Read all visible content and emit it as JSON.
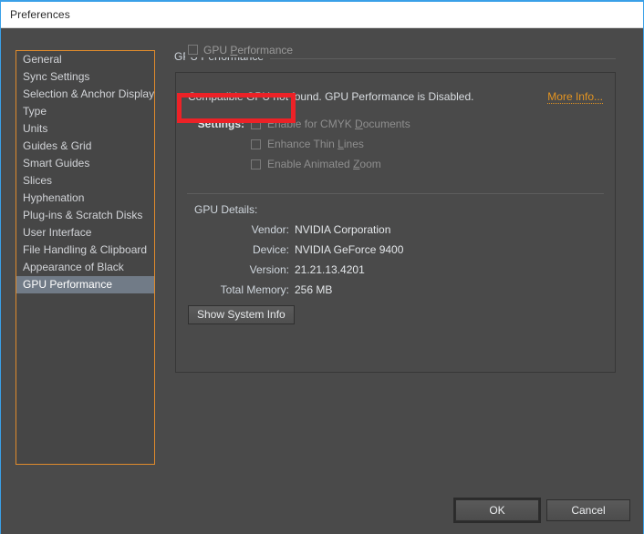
{
  "window": {
    "title": "Preferences",
    "accent_border": "#3aa0e8",
    "background": "#4a4a4a"
  },
  "sidebar": {
    "focus_border_color": "#e08b2c",
    "selected_background": "#717b87",
    "items": [
      {
        "label": "General",
        "selected": false
      },
      {
        "label": "Sync Settings",
        "selected": false
      },
      {
        "label": "Selection & Anchor Display",
        "selected": false
      },
      {
        "label": "Type",
        "selected": false
      },
      {
        "label": "Units",
        "selected": false
      },
      {
        "label": "Guides & Grid",
        "selected": false
      },
      {
        "label": "Smart Guides",
        "selected": false
      },
      {
        "label": "Slices",
        "selected": false
      },
      {
        "label": "Hyphenation",
        "selected": false
      },
      {
        "label": "Plug-ins & Scratch Disks",
        "selected": false
      },
      {
        "label": "User Interface",
        "selected": false
      },
      {
        "label": "File Handling & Clipboard",
        "selected": false
      },
      {
        "label": "Appearance of Black",
        "selected": false
      },
      {
        "label": "GPU Performance",
        "selected": true
      }
    ]
  },
  "pane": {
    "title": "GPU Performance",
    "groupbox": {
      "legend_label_pre": "GPU ",
      "legend_label_mnemonic": "P",
      "legend_label_post": "erformance",
      "legend_checked": false,
      "legend_enabled": false
    },
    "status": {
      "message": "Compatible GPU not found. GPU Performance is Disabled.",
      "more_info_label": "More Info...",
      "more_info_color": "#e39421"
    },
    "settings": {
      "lead_label": "Settings:",
      "options": [
        {
          "pre": "Enable for CMYK ",
          "mnemonic": "D",
          "post": "ocuments",
          "checked": false,
          "enabled": false
        },
        {
          "pre": "Enhance Thin ",
          "mnemonic": "L",
          "post": "ines",
          "checked": false,
          "enabled": false
        },
        {
          "pre": "Enable Animated ",
          "mnemonic": "Z",
          "post": "oom",
          "checked": false,
          "enabled": false
        }
      ]
    },
    "details": {
      "heading": "GPU Details:",
      "rows": [
        {
          "key": "Vendor:",
          "value": "NVIDIA Corporation"
        },
        {
          "key": "Device:",
          "value": "NVIDIA GeForce 9400"
        },
        {
          "key": "Version:",
          "value": "21.21.13.4201"
        },
        {
          "key": "Total Memory:",
          "value": "256 MB"
        }
      ]
    },
    "show_system_info_label": "Show System Info"
  },
  "annotation": {
    "highlight_color": "#ec2227",
    "target": "GPU Performance checkbox"
  },
  "footer": {
    "ok_label": "OK",
    "cancel_label": "Cancel"
  }
}
